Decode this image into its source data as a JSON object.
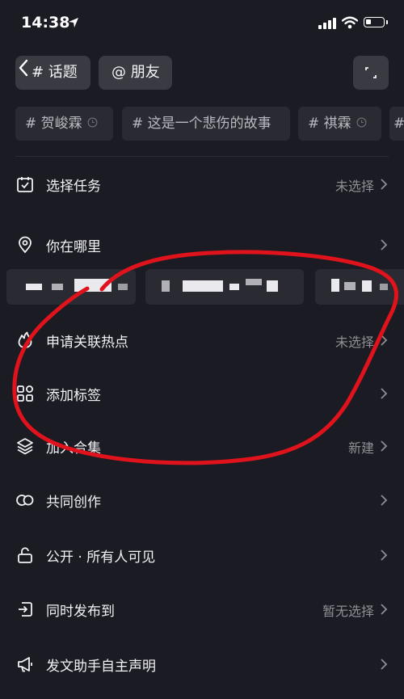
{
  "status_bar": {
    "time": "14:38"
  },
  "chips": {
    "topic": "# 话题",
    "friend": "@ 朋友"
  },
  "recent_tags": [
    "# 贺峻霖",
    "# 这是一个悲伤的故事",
    "# 祺霖",
    "#"
  ],
  "rows": [
    {
      "label": "选择任务",
      "value": "未选择",
      "icon": "task-calendar-icon"
    },
    {
      "label": "你在哪里",
      "value": "",
      "icon": "location-pin-icon"
    },
    {
      "label": "申请关联热点",
      "value": "未选择",
      "icon": "flame-icon"
    },
    {
      "label": "添加标签",
      "value": "",
      "icon": "tags-grid-icon"
    },
    {
      "label": "加入合集",
      "value": "新建",
      "icon": "layers-icon"
    },
    {
      "label": "共同创作",
      "value": "",
      "icon": "co-create-icon"
    },
    {
      "label": "公开 · 所有人可见",
      "value": "",
      "icon": "unlock-icon"
    },
    {
      "label": "同时发布到",
      "value": "暂无选择",
      "icon": "share-out-icon"
    },
    {
      "label": "发文助手自主声明",
      "value": "",
      "icon": "megaphone-icon"
    }
  ],
  "colors": {
    "background": "#1b1c23",
    "chip": "#393a42",
    "tag": "#2a2b32",
    "annotation": "#e0121b"
  }
}
